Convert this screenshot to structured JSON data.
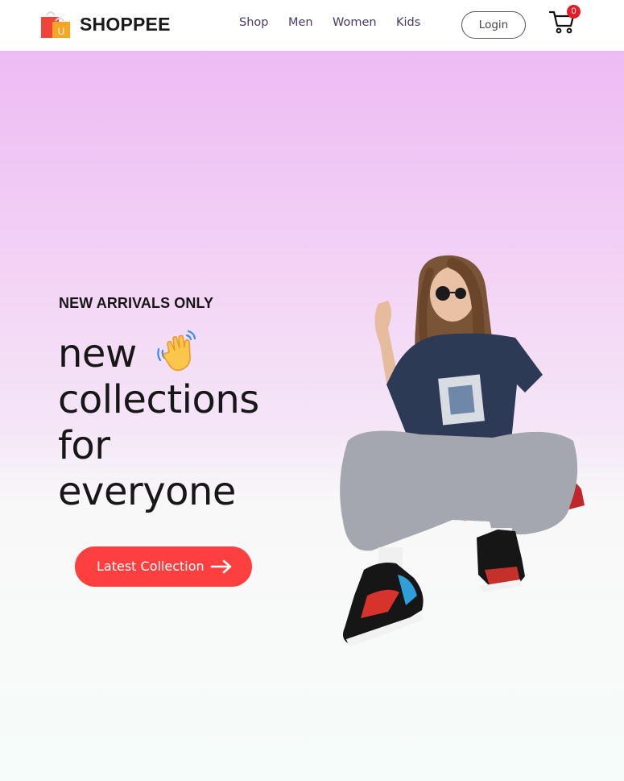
{
  "brand": {
    "name": "SHOPPEE",
    "logo_icon": "shopping-bags-icon",
    "logo_letter": "U"
  },
  "nav": {
    "links": [
      {
        "label": "Shop"
      },
      {
        "label": "Men"
      },
      {
        "label": "Women"
      },
      {
        "label": "Kids"
      }
    ],
    "login_label": "Login",
    "cart_icon": "cart-icon",
    "cart_count": "0"
  },
  "hero": {
    "eyebrow": "NEW ARRIVALS ONLY",
    "headline": [
      "new",
      "collections",
      "for",
      "everyone"
    ],
    "wave_icon": "waving-hand-icon",
    "cta_label": "Latest Collection",
    "cta_icon": "arrow-right-icon",
    "image": "model-photo"
  },
  "colors": {
    "accent": "#fe3f3f",
    "nav_text": "#4b3a66",
    "badge": "#e51c23",
    "gradient_top": "#edbbf4",
    "gradient_bottom": "#f6fcf9"
  }
}
